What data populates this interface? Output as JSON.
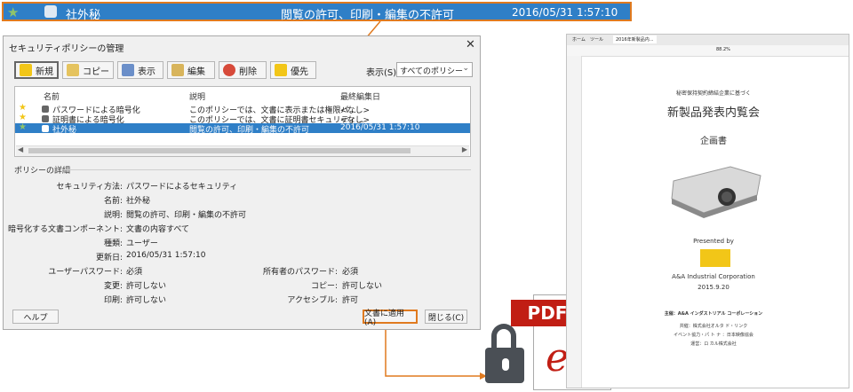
{
  "banner": {
    "name": "社外秘",
    "description": "閲覧の許可、印刷・編集の不許可",
    "date": "2016/05/31 1:57:10"
  },
  "dialog": {
    "title": "セキュリティポリシーの管理",
    "close": "✕",
    "toolbar": [
      "新規",
      "コピー",
      "表示",
      "編集",
      "削除",
      "優先"
    ],
    "view_label": "表示(S)",
    "view_value": "すべてのポリシー",
    "columns": [
      "名前",
      "説明",
      "最終編集日"
    ],
    "rows": [
      {
        "name": "パスワードによる暗号化",
        "desc": "このポリシーでは、文書に表示または権限パ...",
        "date": "<なし>"
      },
      {
        "name": "証明書による暗号化",
        "desc": "このポリシーでは、文書に証明書セキュリティ...",
        "date": "<なし>"
      },
      {
        "name": "社外秘",
        "desc": "閲覧の許可、印刷・編集の不許可",
        "date": "2016/05/31 1:57:10"
      }
    ],
    "details_title": "ポリシーの詳細",
    "details": [
      {
        "k": "セキュリティ方法:",
        "v": "パスワードによるセキュリティ"
      },
      {
        "k": "名前:",
        "v": "社外秘"
      },
      {
        "k": "説明:",
        "v": "閲覧の許可、印刷・編集の不許可"
      },
      {
        "k": "暗号化する文書コンポーネント:",
        "v": "文書の内容すべて"
      },
      {
        "k": "種類:",
        "v": "ユーザー"
      },
      {
        "k": "更新日:",
        "v": "2016/05/31 1:57:10"
      }
    ],
    "details_pairs": [
      {
        "k1": "ユーザーパスワード:",
        "v1": "必須",
        "k2": "所有者のパスワード:",
        "v2": "必須"
      },
      {
        "k1": "変更:",
        "v1": "許可しない",
        "k2": "コピー:",
        "v2": "許可しない"
      },
      {
        "k1": "印刷:",
        "v1": "許可しない",
        "k2": "アクセシブル:",
        "v2": "許可"
      }
    ],
    "help": "ヘルプ",
    "apply": "文書に適用(A)",
    "close_btn": "閉じる(C)"
  },
  "pdf_icon": {
    "label": "PDF"
  },
  "viewer": {
    "tab_home": "ホーム",
    "tab_tools": "ツール",
    "tab_doc": "2016年新製品内...",
    "zoom": "88.2%",
    "lines": {
      "pre": "秘密保持契約締結企業に基づく",
      "title": "新製品発表内覧会",
      "subtitle": "企画書",
      "presented": "Presented by",
      "company": "A&A Industrial Corporation",
      "date": "2015.9.20",
      "host": "主催：A&A インダストリアル コーポレーション",
      "co1": "共催：株式会社オルタ ド・リンク",
      "co2": "イベント協力・パ ト ナ ：日本映像協会",
      "co3": "運営：ロ カル株式会社"
    }
  },
  "colors": {
    "accent": "#e07a1f",
    "selection": "#2f7fc7",
    "pdf_red": "#c11e14"
  }
}
